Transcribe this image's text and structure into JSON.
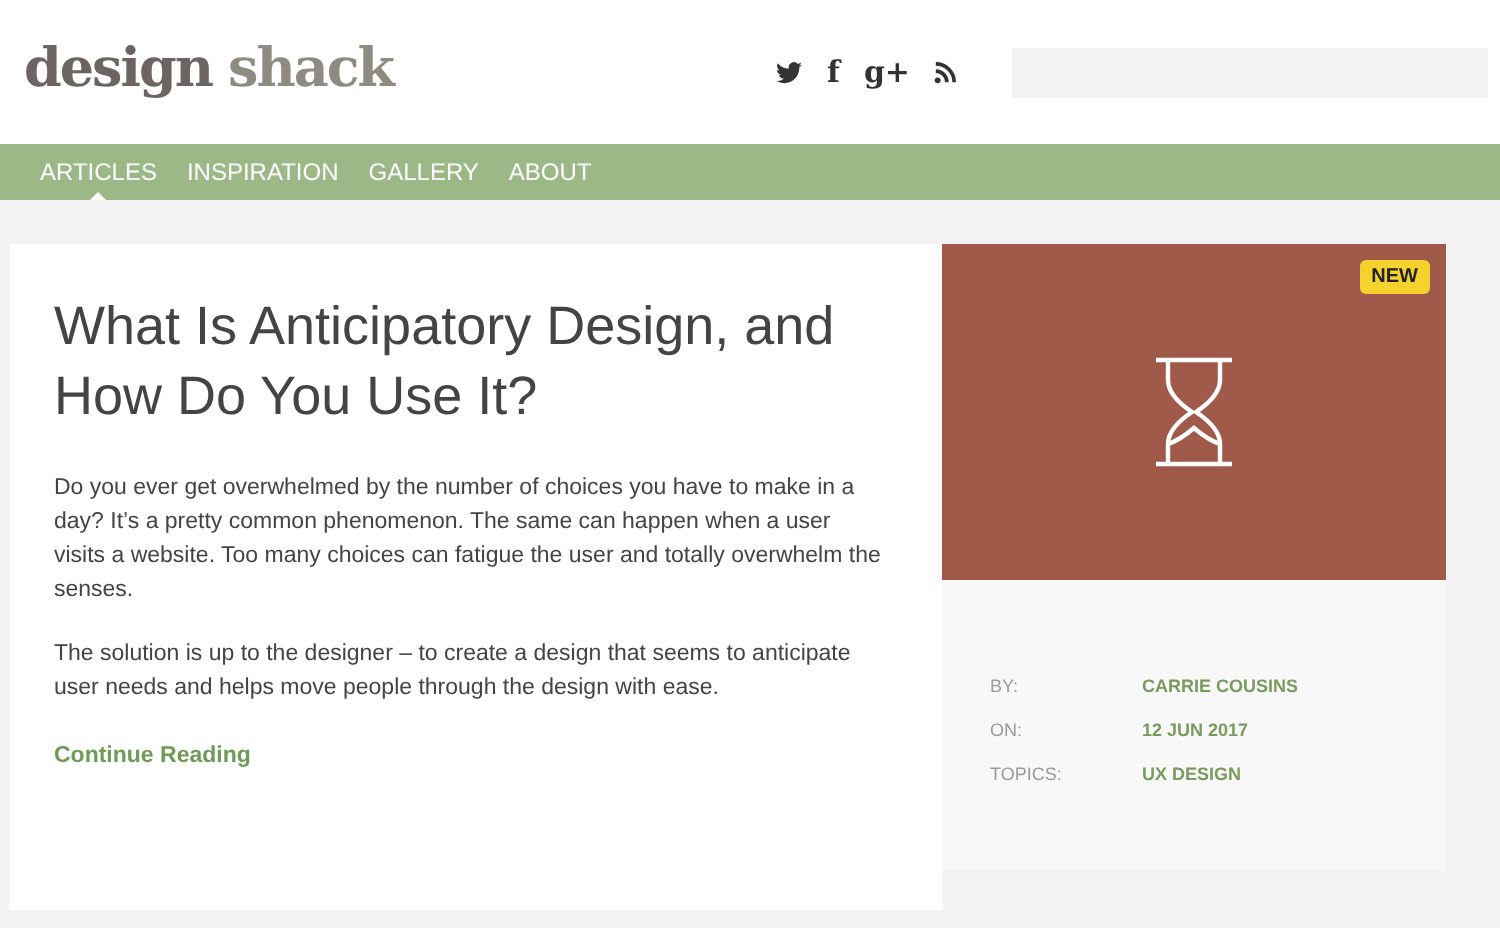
{
  "logo": {
    "first": "design",
    "second": "shack"
  },
  "social": [
    {
      "kind": "bird"
    },
    {
      "kind": "text",
      "label": "f"
    },
    {
      "kind": "text",
      "label": "g+"
    },
    {
      "kind": "feed"
    }
  ],
  "nav": [
    {
      "label": "ARTICLES",
      "selected": true
    },
    {
      "label": "INSPIRATION",
      "selected": false
    },
    {
      "label": "GALLERY",
      "selected": false
    },
    {
      "label": "ABOUT",
      "selected": false
    }
  ],
  "article": {
    "title": "What Is Anticipatory Design, and How Do You Use It?",
    "paragraphs": [
      "Do you ever get overwhelmed by the number of choices you have to make in a day? It’s a pretty common phenomenon. The same can happen when a user visits a website. Too many choices can fatigue the user and totally overwhelm the senses.",
      "The solution is up to the designer – to create a design that seems to anticipate user needs and helps move people through the design with ease."
    ],
    "link": "Continue Reading"
  },
  "feature": {
    "badge": "NEW",
    "meta": [
      {
        "label": "BY:",
        "value": "CARRIE COUSINS"
      },
      {
        "label": "ON:",
        "value": "12 JUN 2017"
      },
      {
        "label": "TOPICS:",
        "value": "UX DESIGN"
      }
    ]
  }
}
